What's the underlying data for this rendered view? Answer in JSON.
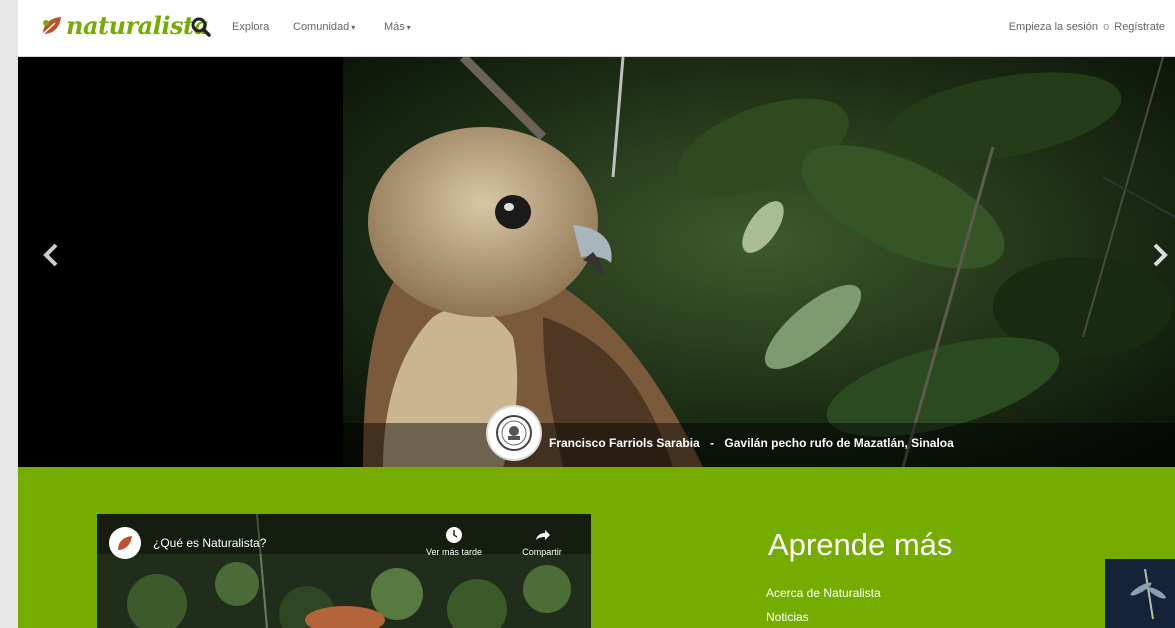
{
  "brand": {
    "name": "naturalista",
    "accent": "#74ac00"
  },
  "nav": {
    "explore": "Explora",
    "community": "Comunidad",
    "more": "Más",
    "login": "Empieza la sesión",
    "separator": "o",
    "signup": "Regístrate",
    "search_icon": "search-icon"
  },
  "hero": {
    "photographer": "Francisco Farriols Sarabia",
    "dash": "-",
    "description": "Gavilán pecho rufo de Mazatlán, Sinaloa",
    "prev_icon": "chevron-left-icon",
    "next_icon": "chevron-right-icon"
  },
  "video": {
    "title": "¿Qué es Naturalista?",
    "watch_later": "Ver más tarde",
    "share": "Compartir"
  },
  "learn": {
    "title": "Aprende más",
    "links": [
      "Acerca de Naturalista",
      "Noticias"
    ]
  }
}
